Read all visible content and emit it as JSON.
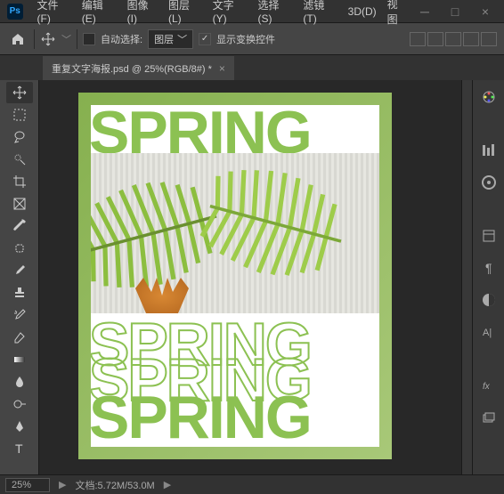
{
  "menu": {
    "file": "文件(F)",
    "edit": "编辑(E)",
    "image": "图像(I)",
    "layer": "图层(L)",
    "type": "文字(Y)",
    "select": "选择(S)",
    "filter": "滤镜(T)",
    "threed": "3D(D)",
    "view": "视图"
  },
  "options": {
    "auto_select": "自动选择:",
    "layer_dd": "图层",
    "show_transform": "显示变换控件"
  },
  "document": {
    "tab_title": "重复文字海报.psd @ 25%(RGB/8#) *"
  },
  "canvas": {
    "text": "SPRING"
  },
  "status": {
    "zoom": "25%",
    "doc_info": "文档:5.72M/53.0M"
  }
}
